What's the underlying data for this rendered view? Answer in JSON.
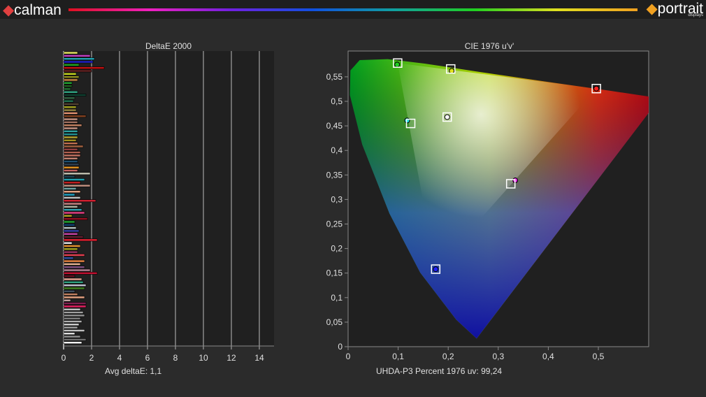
{
  "header": {
    "left_logo": "calman",
    "right_logo": "portrait",
    "right_logo_sub": "displays"
  },
  "chart_data": [
    {
      "type": "bar",
      "title": "DeltaE 2000",
      "orientation": "horizontal",
      "xlim": [
        0,
        15
      ],
      "xticks": [
        "0",
        "2",
        "4",
        "6",
        "8",
        "10",
        "12",
        "14"
      ],
      "footer": "Avg deltaE:  1,1",
      "values": [
        1.0,
        1.9,
        2.2,
        2.1,
        1.1,
        2.9,
        2.0,
        0.9,
        1.1,
        1.0,
        0.6,
        0.6,
        0.5,
        1.0,
        1.6,
        0.8,
        0.7,
        1.1,
        0.9,
        0.9,
        1.0,
        1.6,
        1.0,
        1.0,
        1.3,
        1.0,
        1.0,
        1.0,
        1.0,
        0.9,
        1.0,
        1.4,
        1.0,
        1.2,
        1.2,
        1.0,
        1.0,
        1.1,
        1.1,
        1.0,
        1.9,
        0.8,
        1.5,
        1.2,
        1.9,
        0.9,
        1.2,
        0.8,
        1.2,
        2.3,
        1.3,
        1.0,
        1.3,
        1.5,
        0.6,
        1.7,
        0.8,
        0.8,
        0.9,
        1.1,
        1.0,
        1.4,
        2.4,
        0.6,
        1.2,
        1.0,
        1.0,
        1.5,
        0.7,
        1.5,
        1.2,
        1.5,
        1.9,
        2.4,
        0.8,
        1.3,
        1.4,
        1.6,
        1.5,
        0.8,
        1.0,
        1.5,
        0.5,
        1.6,
        1.6,
        1.2,
        1.4,
        1.5,
        1.2,
        1.3,
        1.1,
        1.0,
        1.5,
        0.8,
        1.2,
        1.6,
        1.3
      ],
      "colors": [
        "#e0e060",
        "#c040c0",
        "#20a0b0",
        "#2020c0",
        "#20a020",
        "#c01010",
        "#602020",
        "#c0d020",
        "#909020",
        "#c08040",
        "#20a030",
        "#206020",
        "#207030",
        "#30a080",
        "#104030",
        "#306040",
        "#207050",
        "#504030",
        "#a0a020",
        "#908040",
        "#e09070",
        "#804020",
        "#c09080",
        "#a07060",
        "#c08060",
        "#c09080",
        "#30a0a0",
        "#209090",
        "#b0a030",
        "#a09020",
        "#c07050",
        "#a06040",
        "#904040",
        "#b06050",
        "#c07060",
        "#c08070",
        "#205070",
        "#304050",
        "#e09020",
        "#c06060",
        "#c0c0b0",
        "#204050",
        "#20a0b0",
        "#c02020",
        "#c09080",
        "#70a0a0",
        "#e0a080",
        "#20a0c0",
        "#c0c0c0",
        "#d02030",
        "#c08080",
        "#b0b0a0",
        "#30a0b0",
        "#e04080",
        "#b0a020",
        "#901020",
        "#20a030",
        "#104070",
        "#b0c0c0",
        "#3040a0",
        "#c040a0",
        "#602030",
        "#e02030",
        "#e0e0e0",
        "#e09030",
        "#a0a020",
        "#903060",
        "#e04050",
        "#3050a0",
        "#e08040",
        "#e0b090",
        "#805080",
        "#b08090",
        "#c01030",
        "#601020",
        "#e0a090",
        "#30a080",
        "#c0c0d0",
        "#408020",
        "#405060",
        "#c08060",
        "#e0a080",
        "#c0a0a0",
        "#802050",
        "#e02060",
        "#c0c0c0",
        "#a0a0a0",
        "#909090",
        "#808080",
        "#b0b0b0",
        "#d0d0d0",
        "#a0a0a0",
        "#c0c0c0",
        "#e0e0e0",
        "#909090",
        "#707070",
        "#f0f0f0"
      ]
    },
    {
      "type": "scatter",
      "title": "CIE 1976 u'v'",
      "xlim": [
        0,
        0.6
      ],
      "ylim": [
        0,
        0.6
      ],
      "xticks": [
        "0",
        "0,1",
        "0,2",
        "0,3",
        "0,4",
        "0,5"
      ],
      "yticks": [
        "0",
        "0,05",
        "0,1",
        "0,15",
        "0,2",
        "0,25",
        "0,3",
        "0,35",
        "0,4",
        "0,45",
        "0,5",
        "0,55"
      ],
      "footer": "UHDA-P3 Percent 1976 uv: 99,24",
      "targets": [
        {
          "name": "red",
          "u": 0.496,
          "v": 0.526
        },
        {
          "name": "green",
          "u": 0.099,
          "v": 0.578
        },
        {
          "name": "blue",
          "u": 0.175,
          "v": 0.158
        },
        {
          "name": "white",
          "u": 0.198,
          "v": 0.468
        },
        {
          "name": "cyan",
          "u": 0.125,
          "v": 0.455
        },
        {
          "name": "magenta",
          "u": 0.325,
          "v": 0.332
        },
        {
          "name": "yellow",
          "u": 0.205,
          "v": 0.566
        }
      ],
      "measured": [
        {
          "name": "red",
          "u": 0.496,
          "v": 0.526,
          "color": "#ff2020"
        },
        {
          "name": "green",
          "u": 0.098,
          "v": 0.575,
          "color": "#20d020"
        },
        {
          "name": "blue",
          "u": 0.175,
          "v": 0.158,
          "color": "#2020ff"
        },
        {
          "name": "white",
          "u": 0.198,
          "v": 0.468,
          "color": "#ffffff"
        },
        {
          "name": "cyan",
          "u": 0.118,
          "v": 0.461,
          "color": "#20e0e0"
        },
        {
          "name": "magenta",
          "u": 0.334,
          "v": 0.339,
          "color": "#e020e0"
        },
        {
          "name": "yellow",
          "u": 0.207,
          "v": 0.562,
          "color": "#e0e020"
        }
      ]
    }
  ]
}
